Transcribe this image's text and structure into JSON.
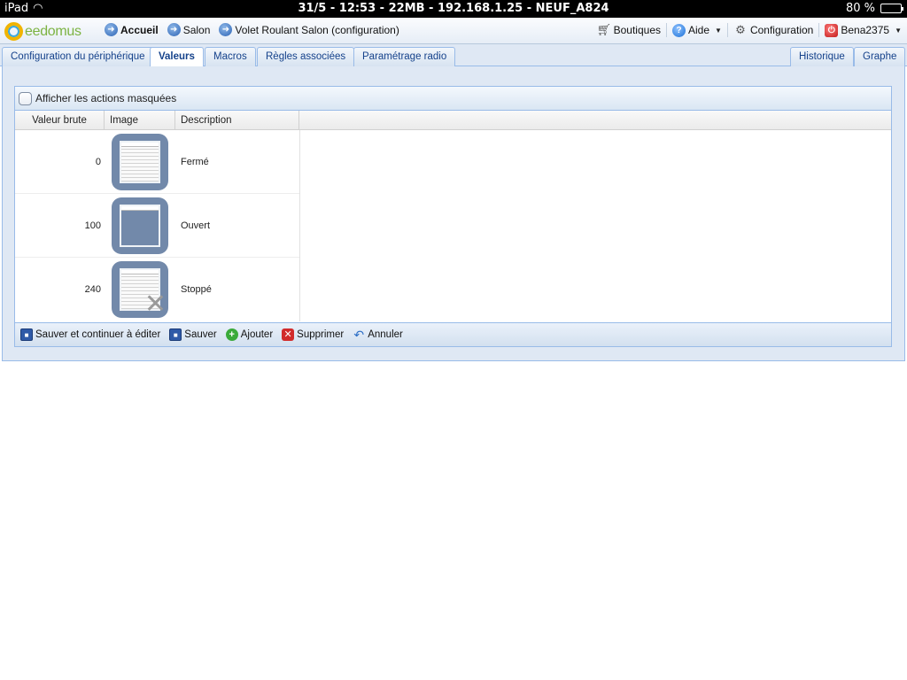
{
  "statusbar": {
    "device": "iPad",
    "center": "31/5 - 12:53 - 22MB - 192.168.1.25 - NEUF_A824",
    "battery_percent": "80 %",
    "battery_level": 0.8
  },
  "toolbar": {
    "logo_text": "eedomus",
    "breadcrumb": [
      {
        "label": "Accueil",
        "icon": "arrow-circle-icon"
      },
      {
        "label": "Salon",
        "icon": "arrow-circle-icon"
      },
      {
        "label": "Volet Roulant Salon (configuration)",
        "icon": "arrow-circle-icon"
      }
    ],
    "right": {
      "shops": "Boutiques",
      "help": "Aide",
      "config": "Configuration",
      "user": "Bena2375"
    }
  },
  "tabs": {
    "left": [
      "Configuration du périphérique",
      "Valeurs",
      "Macros",
      "Règles associées",
      "Paramétrage radio"
    ],
    "active": "Valeurs",
    "right": [
      "Historique",
      "Graphe"
    ]
  },
  "grid": {
    "checkbox_label": "Afficher les actions masquées",
    "columns": [
      "Valeur brute",
      "Image",
      "Description"
    ],
    "rows": [
      {
        "value": "0",
        "image": "shutter-closed-icon",
        "description": "Fermé"
      },
      {
        "value": "100",
        "image": "shutter-open-icon",
        "description": "Ouvert"
      },
      {
        "value": "240",
        "image": "shutter-stopped-icon",
        "description": "Stoppé"
      }
    ],
    "buttons": {
      "save_continue": "Sauver et continuer à éditer",
      "save": "Sauver",
      "add": "Ajouter",
      "delete": "Supprimer",
      "cancel": "Annuler"
    }
  }
}
